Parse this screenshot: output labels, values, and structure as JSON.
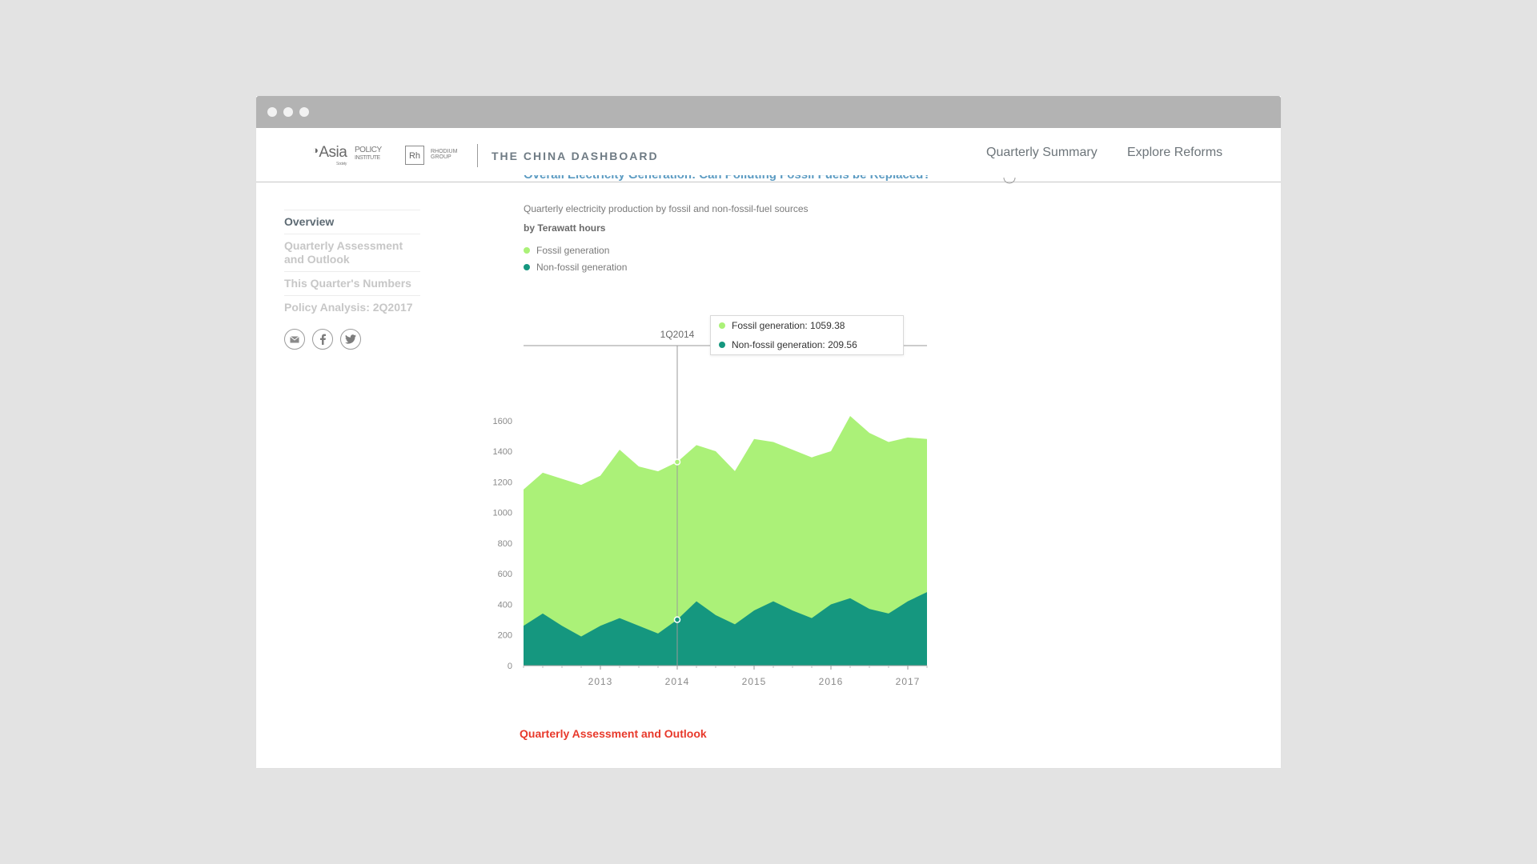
{
  "header": {
    "logo_asia": "Asia",
    "logo_asia_policy": "POLICY",
    "logo_asia_institute": "INSTITUTE",
    "logo_asia_society": "Society",
    "logo_rh": "Rh",
    "logo_rhodium": "RHODIUM",
    "logo_group": "GROUP",
    "brand_title": "THE CHINA DASHBOARD",
    "nav": [
      {
        "label": "Quarterly Summary"
      },
      {
        "label": "Explore Reforms"
      }
    ]
  },
  "sidebar": {
    "items": [
      {
        "label": "Overview",
        "active": true
      },
      {
        "label": "Quarterly Assessment and Outlook",
        "active": false
      },
      {
        "label": "This Quarter's Numbers",
        "active": false
      },
      {
        "label": "Policy Analysis: 2Q2017",
        "active": false
      }
    ],
    "social_icons": [
      "email-icon",
      "facebook-icon",
      "twitter-icon"
    ]
  },
  "chart_header": {
    "title": "Overall Electricity Generation: Can Polluting Fossil Fuels be Replaced?",
    "subtitle": "Quarterly electricity production by fossil and non-fossil-fuel sources",
    "unit": "by Terawatt hours"
  },
  "colors": {
    "fossil": "#abf178",
    "nonfossil": "#15977f",
    "nav_text": "#6d757a",
    "section_heading": "#e8392b"
  },
  "chart_data": {
    "type": "area",
    "stacked": true,
    "x": [
      "1Q2012",
      "2Q2012",
      "3Q2012",
      "4Q2012",
      "1Q2013",
      "2Q2013",
      "3Q2013",
      "4Q2013",
      "1Q2014",
      "2Q2014",
      "3Q2014",
      "4Q2014",
      "1Q2015",
      "2Q2015",
      "3Q2015",
      "4Q2015",
      "1Q2016",
      "2Q2016",
      "3Q2016",
      "4Q2016",
      "1Q2017",
      "2Q2017"
    ],
    "series": [
      {
        "name": "Fossil generation",
        "values": [
          890,
          920,
          960,
          990,
          980,
          1100,
          1040,
          1059.38,
          1030,
          1020,
          1070,
          1000,
          1120,
          1040,
          1050,
          1050,
          1000,
          1190,
          1150,
          1120,
          1070,
          1000
        ]
      },
      {
        "name": "Non-fossil generation",
        "values": [
          260,
          340,
          260,
          190,
          260,
          310,
          260,
          209.56,
          300,
          420,
          330,
          270,
          360,
          420,
          360,
          310,
          400,
          440,
          370,
          340,
          420,
          480
        ]
      }
    ],
    "ylim": [
      0,
      1700
    ],
    "yticks": [
      0,
      200,
      400,
      600,
      800,
      1000,
      1200,
      1400,
      1600
    ],
    "xticks": [
      "2013",
      "2014",
      "2015",
      "2016",
      "2017"
    ],
    "xtick_quarters": [
      "1Q2013",
      "1Q2014",
      "1Q2015",
      "1Q2016",
      "1Q2017"
    ],
    "legend": [
      "Fossil generation",
      "Non-fossil generation"
    ],
    "hover_label": "1Q2014",
    "tooltip": [
      {
        "label": "Fossil generation: 1059.38"
      },
      {
        "label": "Non-fossil generation: 209.56"
      }
    ],
    "grid": false
  },
  "section_heading": "Quarterly Assessment and Outlook"
}
